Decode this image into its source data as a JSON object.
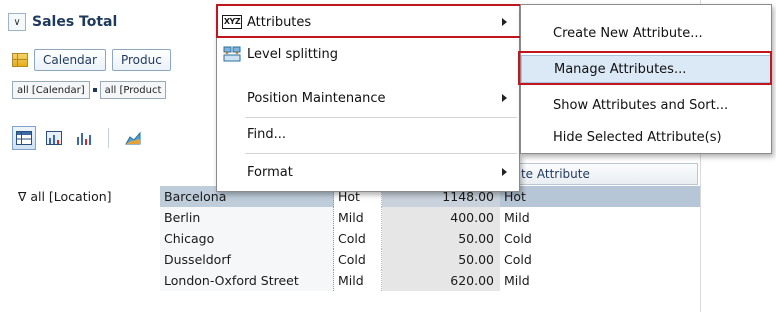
{
  "panel": {
    "title": "Sales Total",
    "dim_buttons": [
      "Calendar",
      "Produc"
    ],
    "chips": [
      "all [Calendar]",
      "all [Product"
    ],
    "column_header": "re Climate Attribute"
  },
  "table": {
    "location": "∇ all [Location]",
    "rows": [
      {
        "city": "Barcelona",
        "temp": "Hot",
        "value": "1148.00",
        "attr": "Hot"
      },
      {
        "city": "Berlin",
        "temp": "Mild",
        "value": "400.00",
        "attr": "Mild"
      },
      {
        "city": "Chicago",
        "temp": "Cold",
        "value": "50.00",
        "attr": "Cold"
      },
      {
        "city": "Dusseldorf",
        "temp": "Cold",
        "value": "50.00",
        "attr": "Cold"
      },
      {
        "city": "London-Oxford Street",
        "temp": "Mild",
        "value": "620.00",
        "attr": "Mild"
      }
    ]
  },
  "context_menu": {
    "items": [
      {
        "label": "Attributes",
        "icon": "xyz-icon",
        "has_submenu": true
      },
      {
        "label": "Level splitting",
        "icon": "level-split-icon",
        "has_submenu": false
      },
      {
        "label": "Position Maintenance",
        "icon": "",
        "has_submenu": true
      },
      {
        "label": "Find...",
        "icon": "",
        "has_submenu": false
      },
      {
        "label": "Format",
        "icon": "",
        "has_submenu": true
      }
    ]
  },
  "submenu": {
    "items": [
      {
        "label": "Create New Attribute..."
      },
      {
        "label": "Manage Attributes...",
        "highlighted": true
      },
      {
        "label": "Show Attributes and Sort..."
      },
      {
        "label": "Hide Selected Attribute(s)"
      }
    ]
  },
  "colors": {
    "highlight_box": "#c0161d",
    "selected_row": "#bfcddb",
    "menu_hover": "#dbe8f5"
  }
}
